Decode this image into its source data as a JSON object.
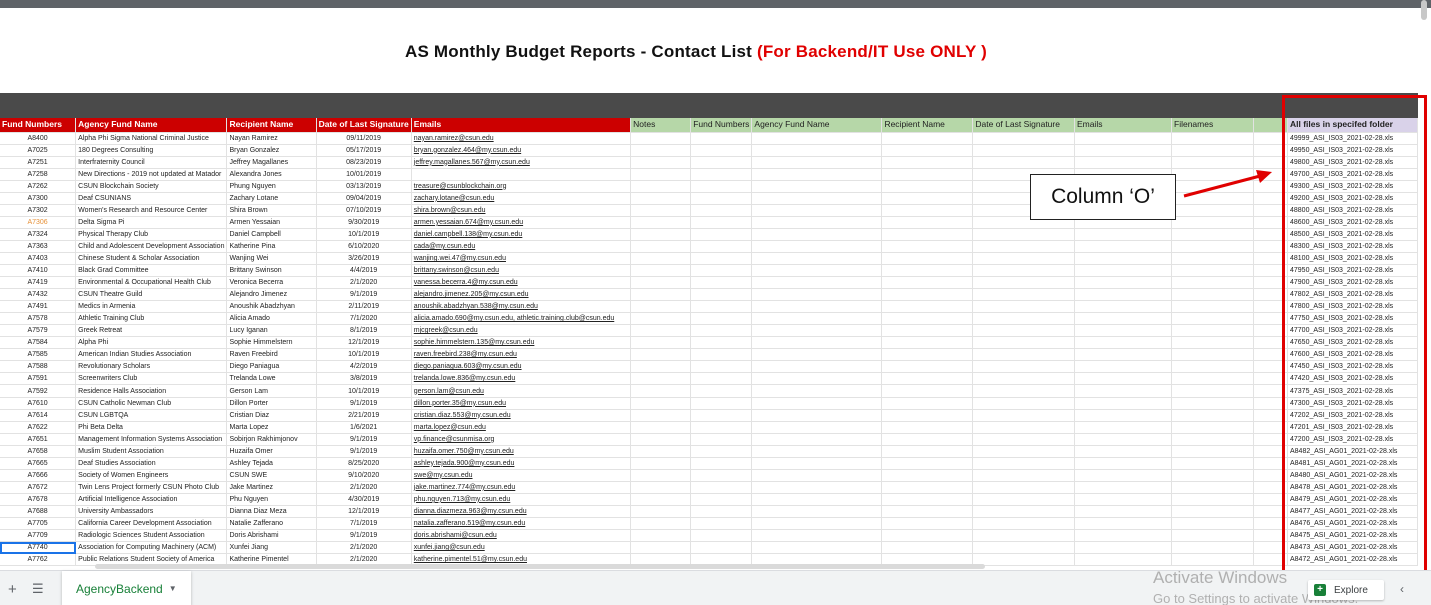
{
  "title": {
    "main": "AS Monthly Budget  Reports - Contact List",
    "note": "(For Backend/IT Use ONLY )"
  },
  "headers": [
    "Fund Numbers",
    "Agency Fund Name",
    "Recipient Name",
    "Date of Last Signature",
    "Emails",
    "Notes",
    "Fund Numbers",
    "Agency Fund Name",
    "Recipient Name",
    "Date of Last Signature",
    "Emails",
    "Filenames",
    "",
    "All files in specifed folder"
  ],
  "header_styles": [
    "red",
    "red",
    "red",
    "red",
    "red",
    "green",
    "green",
    "green",
    "green",
    "green",
    "green",
    "green",
    "green",
    "lav"
  ],
  "rows": [
    {
      "fund": "A8400",
      "name": "Alpha Phi Sigma National Criminal Justice",
      "recipient": "Nayan Ramirez",
      "date": "09/11/2019",
      "email": "nayan.ramirez@csun.edu",
      "file": "49999_ASI_IS03_2021-02-28.xls"
    },
    {
      "fund": "A7025",
      "name": "180 Degrees Consulting",
      "recipient": "Bryan Gonzalez",
      "date": "05/17/2019",
      "email": "bryan.gonzalez.464@my.csun.edu",
      "file": "49950_ASI_IS03_2021-02-28.xls"
    },
    {
      "fund": "A7251",
      "name": "Interfraternity Council",
      "recipient": "Jeffrey Magallanes",
      "date": "08/23/2019",
      "email": "jeffrey.magallanes.567@my.csun.edu",
      "file": "49800_ASI_IS03_2021-02-28.xls"
    },
    {
      "fund": "A7258",
      "name": "New Directions - 2019 not updated at Matador",
      "recipient": "Alexandra Jones",
      "date": "10/01/2019",
      "email": "",
      "file": "49700_ASI_IS03_2021-02-28.xls"
    },
    {
      "fund": "A7262",
      "name": "CSUN Blockchain Society",
      "recipient": "Phung Nguyen",
      "date": "03/13/2019",
      "email": "treasure@csunblockchain.org",
      "file": "49300_ASI_IS03_2021-02-28.xls"
    },
    {
      "fund": "A7300",
      "name": "Deaf CSUNIANS",
      "recipient": "Zachary Lotane",
      "date": "09/04/2019",
      "email": "zachary.lotane@csun.edu",
      "file": "49200_ASI_IS03_2021-02-28.xls"
    },
    {
      "fund": "A7302",
      "name": "Women's Research and Resource Center",
      "recipient": "Shira Brown",
      "date": "07/10/2019",
      "email": "shira.brown@csun.edu",
      "file": "48800_ASI_IS03_2021-02-28.xls"
    },
    {
      "fund": "A7306",
      "name": "Delta Sigma Pi",
      "recipient": "Armen Yessaian",
      "date": "9/30/2019",
      "email": "armen.yessaian.674@my.csun.edu",
      "file": "48600_ASI_IS03_2021-02-28.xls",
      "orange": true
    },
    {
      "fund": "A7324",
      "name": "Physical Therapy Club",
      "recipient": "Daniel Campbell",
      "date": "10/1/2019",
      "email": "daniel.campbell.138@my.csun.edu",
      "file": "48500_ASI_IS03_2021-02-28.xls"
    },
    {
      "fund": "A7363",
      "name": "Child and Adolescent Development Association",
      "recipient": "Katherine Pina",
      "date": "6/10/2020",
      "email": "cada@my.csun.edu",
      "file": "48300_ASI_IS03_2021-02-28.xls"
    },
    {
      "fund": "A7403",
      "name": "Chinese Student & Scholar Association",
      "recipient": "Wanjing Wei",
      "date": "3/26/2019",
      "email": "wanjing.wei.47@my.csun.edu",
      "file": "48100_ASI_IS03_2021-02-28.xls"
    },
    {
      "fund": "A7410",
      "name": "Black Grad Committee",
      "recipient": "Brittany Swinson",
      "date": "4/4/2019",
      "email": "brittany.swinson@csun.edu",
      "file": "47950_ASI_IS03_2021-02-28.xls"
    },
    {
      "fund": "A7419",
      "name": "Environmental & Occupational Health Club",
      "recipient": "Veronica Becerra",
      "date": "2/1/2020",
      "email": "vanessa.becerra.4@my.csun.edu",
      "file": "47900_ASI_IS03_2021-02-28.xls"
    },
    {
      "fund": "A7432",
      "name": "CSUN Theatre Guild",
      "recipient": "Alejandro Jimenez",
      "date": "9/1/2019",
      "email": "alejandro.jimenez.205@my.csun.edu",
      "file": "47802_ASI_IS03_2021-02-28.xls"
    },
    {
      "fund": "A7491",
      "name": "Medics in Armenia",
      "recipient": "Anoushik Abadzhyan",
      "date": "2/11/2019",
      "email": "anoushik.abadzhyan.538@my.csun.edu",
      "file": "47800_ASI_IS03_2021-02-28.xls"
    },
    {
      "fund": "A7578",
      "name": "Athletic Training Club",
      "recipient": "Alicia Amado",
      "date": "7/1/2020",
      "email": "alicia.amado.690@my.csun.edu, athletic.training.club@csun.edu",
      "file": "47750_ASI_IS03_2021-02-28.xls"
    },
    {
      "fund": "A7579",
      "name": "Greek Retreat",
      "recipient": "Lucy Iganan",
      "date": "8/1/2019",
      "email": "mjcgreek@csun.edu",
      "file": "47700_ASI_IS03_2021-02-28.xls"
    },
    {
      "fund": "A7584",
      "name": "Alpha Phi",
      "recipient": "Sophie Himmelstern",
      "date": "12/1/2019",
      "email": "sophie.himmelstern.135@my.csun.edu",
      "file": "47650_ASI_IS03_2021-02-28.xls"
    },
    {
      "fund": "A7585",
      "name": "American Indian Studies Association",
      "recipient": "Raven Freebird",
      "date": "10/1/2019",
      "email": "raven.freebird.238@my.csun.edu",
      "file": "47600_ASI_IS03_2021-02-28.xls"
    },
    {
      "fund": "A7588",
      "name": "Revolutionary Scholars",
      "recipient": "Diego Paniagua",
      "date": "4/2/2019",
      "email": "diego.paniagua.603@my.csun.edu",
      "file": "47450_ASI_IS03_2021-02-28.xls"
    },
    {
      "fund": "A7591",
      "name": "Screenwriters Club",
      "recipient": "Trelanda Lowe",
      "date": "3/8/2019",
      "email": "trelanda.lowe.836@my.csun.edu",
      "file": "47420_ASI_IS03_2021-02-28.xls"
    },
    {
      "fund": "A7592",
      "name": "Residence Halls Association",
      "recipient": "Gerson Lam",
      "date": "10/1/2019",
      "email": "gerson.lam@csun.edu",
      "file": "47375_ASI_IS03_2021-02-28.xls"
    },
    {
      "fund": "A7610",
      "name": "CSUN Catholic Newman Club",
      "recipient": "Dillon Porter",
      "date": "9/1/2019",
      "email": "dillon.porter.35@my.csun.edu",
      "file": "47300_ASI_IS03_2021-02-28.xls"
    },
    {
      "fund": "A7614",
      "name": "CSUN LGBTQA",
      "recipient": "Cristian Diaz",
      "date": "2/21/2019",
      "email": "cristian.diaz.553@my.csun.edu",
      "file": "47202_ASI_IS03_2021-02-28.xls"
    },
    {
      "fund": "A7622",
      "name": "Phi Beta Delta",
      "recipient": "Marta Lopez",
      "date": "1/6/2021",
      "email": "marta.lopez@csun.edu",
      "file": "47201_ASI_IS03_2021-02-28.xls"
    },
    {
      "fund": "A7651",
      "name": "Management Information Systems Association",
      "recipient": "Sobirjon Rakhimjonov",
      "date": "9/1/2019",
      "email": "vp.finance@csunmisa.org",
      "file": "47200_ASI_IS03_2021-02-28.xls"
    },
    {
      "fund": "A7658",
      "name": "Muslim Student Association",
      "recipient": "Huzaifa Omer",
      "date": "9/1/2019",
      "email": "huzaifa.omer.750@my.csun.edu",
      "file": "A8482_ASI_AG01_2021-02-28.xls"
    },
    {
      "fund": "A7665",
      "name": "Deaf Studies Association",
      "recipient": "Ashley Tejada",
      "date": "8/25/2020",
      "email": "ashley.tejada.900@my.csun.edu",
      "file": "A8481_ASI_AG01_2021-02-28.xls"
    },
    {
      "fund": "A7666",
      "name": "Society of Women Engineers",
      "recipient": "CSUN SWE",
      "date": "9/10/2020",
      "email": "swe@my.csun.edu",
      "file": "A8480_ASI_AG01_2021-02-28.xls"
    },
    {
      "fund": "A7672",
      "name": "Twin Lens Project formerly CSUN Photo Club",
      "recipient": "Jake Martinez",
      "date": "2/1/2020",
      "email": "jake.martinez.774@my.csun.edu",
      "file": "A8478_ASI_AG01_2021-02-28.xls"
    },
    {
      "fund": "A7678",
      "name": "Artificial Intelligence Association",
      "recipient": "Phu Nguyen",
      "date": "4/30/2019",
      "email": "phu.nguyen.713@my.csun.edu",
      "file": "A8479_ASI_AG01_2021-02-28.xls"
    },
    {
      "fund": "A7688",
      "name": "University Ambassadors",
      "recipient": "Dianna Diaz Meza",
      "date": "12/1/2019",
      "email": "dianna.diazmeza.963@my.csun.edu",
      "file": "A8477_ASI_AG01_2021-02-28.xls"
    },
    {
      "fund": "A7705",
      "name": "California Career Development Association",
      "recipient": "Natalie Zafferano",
      "date": "7/1/2019",
      "email": "natalia.zafferano.519@my.csun.edu",
      "file": "A8476_ASI_AG01_2021-02-28.xls"
    },
    {
      "fund": "A7709",
      "name": "Radiologic Sciences Student Association",
      "recipient": "Doris Abrishami",
      "date": "9/1/2019",
      "email": "doris.abrishami@csun.edu",
      "file": "A8475_ASI_AG01_2021-02-28.xls"
    },
    {
      "fund": "A7740",
      "name": "Association for Computing Machinery (ACM)",
      "recipient": "Xunfei Jiang",
      "date": "2/1/2020",
      "email": "xunfei.jiang@csun.edu",
      "file": "A8473_ASI_AG01_2021-02-28.xls",
      "selected": true
    },
    {
      "fund": "A7762",
      "name": "Public Relations Student Society of America",
      "recipient": "Katherine Pimentel",
      "date": "2/1/2020",
      "email": "katherine.pimentel.51@my.csun.edu",
      "file": "A8472_ASI_AG01_2021-02-28.xls"
    }
  ],
  "annotation": {
    "label": "Column ‘O’"
  },
  "sheet_tab": {
    "label": "AgencyBackend"
  },
  "watermark": {
    "line1": "Activate Windows",
    "line2": "Go to Settings to activate Windows."
  },
  "explore": {
    "label": "Explore"
  },
  "colors": {
    "header_red": "#cc0000",
    "header_green": "#b6d7a8",
    "header_lavender": "#d9d2e9",
    "highlight_box": "#e00000"
  }
}
